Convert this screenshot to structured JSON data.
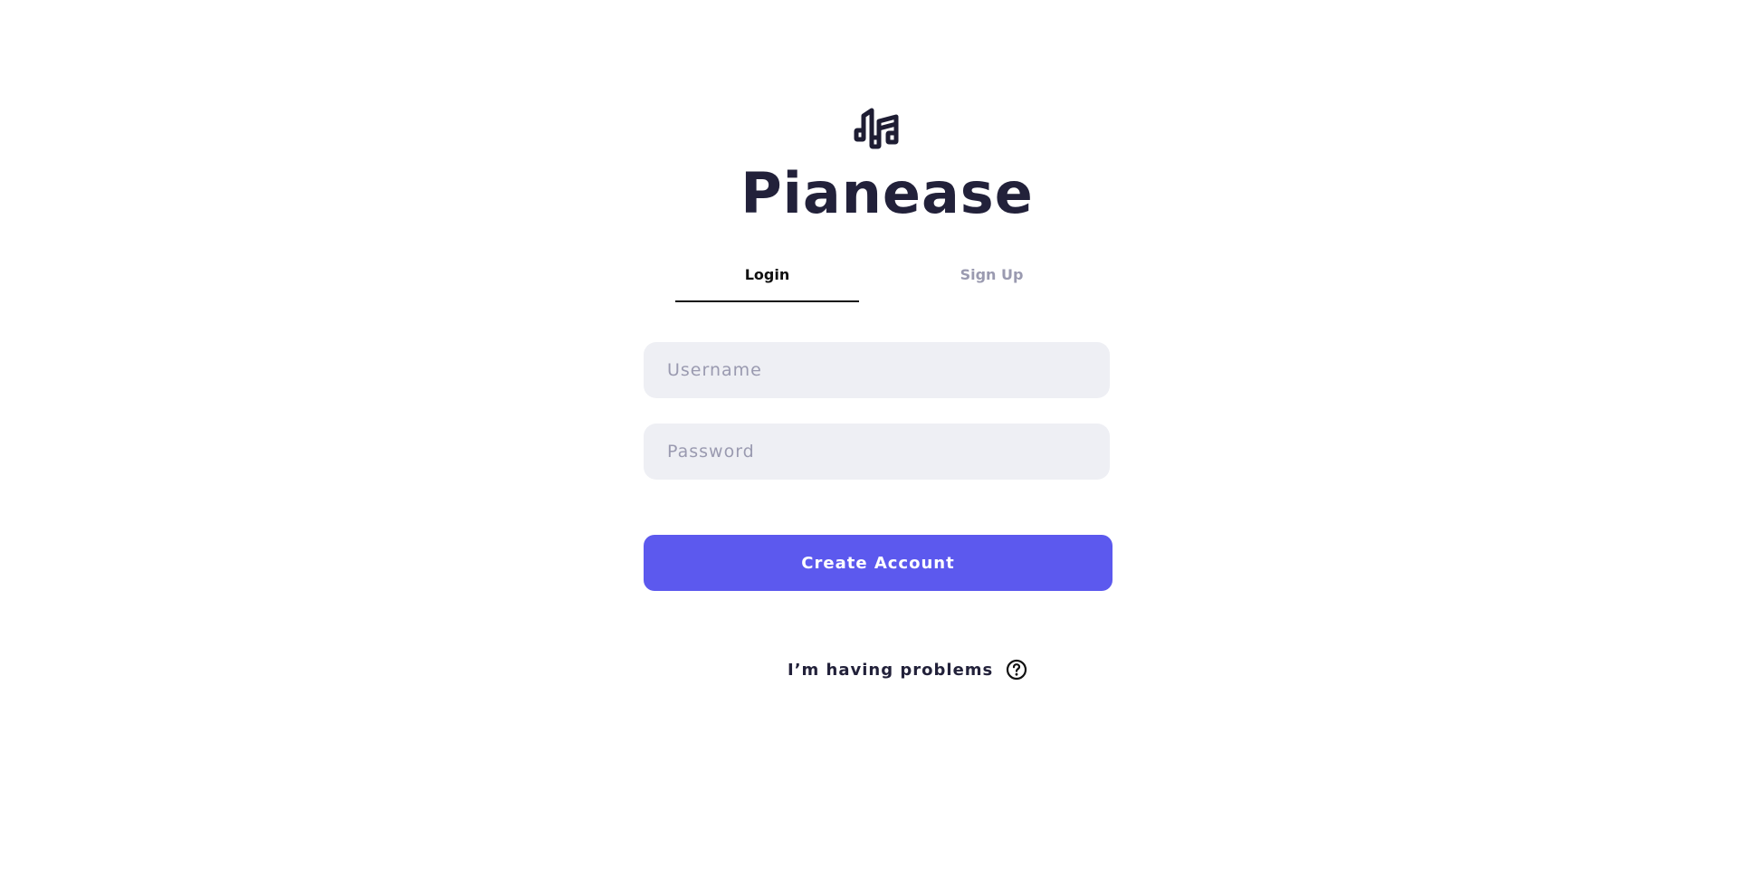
{
  "app": {
    "logo_icon": "music-notes-icon",
    "brand_name": "Pianease"
  },
  "tabs": [
    {
      "label": "Login",
      "active": true
    },
    {
      "label": "Sign Up",
      "active": false
    }
  ],
  "form": {
    "username": {
      "value": "",
      "placeholder": "Username"
    },
    "password": {
      "value": "",
      "placeholder": "Password"
    },
    "submit_label": "Create Account"
  },
  "help": {
    "label": "I’m having problems",
    "icon": "question-circle-icon"
  },
  "colors": {
    "brand_text": "#22213a",
    "primary": "#5c59ee",
    "input_bg": "#eeeff4",
    "muted": "#9a9ab0"
  }
}
